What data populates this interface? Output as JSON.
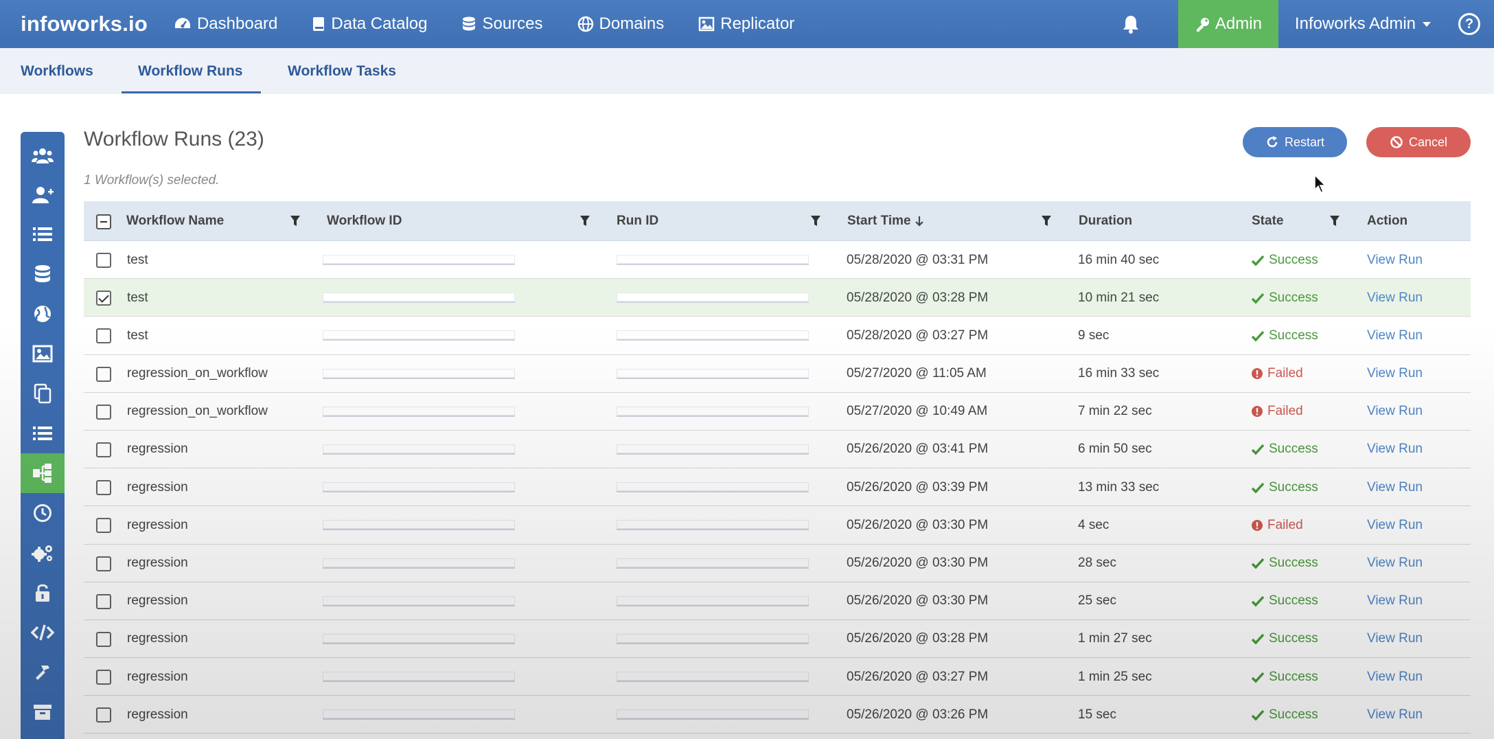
{
  "brand": "infoworks.io",
  "nav": [
    {
      "label": "Dashboard",
      "icon": "dashboard-icon"
    },
    {
      "label": "Data Catalog",
      "icon": "book-icon"
    },
    {
      "label": "Sources",
      "icon": "database-icon"
    },
    {
      "label": "Domains",
      "icon": "globe-icon"
    },
    {
      "label": "Replicator",
      "icon": "replicator-icon"
    }
  ],
  "admin_label": "Admin",
  "user_label": "Infoworks Admin",
  "help_label": "?",
  "subnav": {
    "tab1": "Workflows",
    "tab2": "Workflow Runs",
    "tab3": "Workflow Tasks",
    "active": "Workflow Runs"
  },
  "sidebar_icons": [
    "users-icon",
    "add-user-icon",
    "list-icon",
    "database-icon",
    "globe-icon",
    "image-icon",
    "copy-icon",
    "list-alt-icon",
    "workflow-icon",
    "clock-icon",
    "settings-icon",
    "unlock-icon",
    "code-icon",
    "hammer-icon",
    "archive-icon"
  ],
  "page": {
    "title": "Workflow Runs (23)",
    "selected_note": "1 Workflow(s) selected."
  },
  "buttons": {
    "restart": "Restart",
    "cancel": "Cancel"
  },
  "columns": {
    "name": "Workflow Name",
    "workflow_id": "Workflow ID",
    "run_id": "Run ID",
    "start_time": "Start Time",
    "duration": "Duration",
    "state": "State",
    "action": "Action"
  },
  "colors": {
    "navbar": "#3f6fb3",
    "admin": "#5fb85e",
    "restart": "#4f7fc4",
    "cancel": "#d9605a",
    "success": "#4a9a3c",
    "failed": "#d0574f",
    "link": "#4d86c9"
  },
  "rows": [
    {
      "name": "test",
      "start": "05/28/2020 @ 03:31 PM",
      "duration": "16 min 40 sec",
      "state": "Success",
      "action": "View Run",
      "checked": false
    },
    {
      "name": "test",
      "start": "05/28/2020 @ 03:28 PM",
      "duration": "10 min 21 sec",
      "state": "Success",
      "action": "View Run",
      "checked": true
    },
    {
      "name": "test",
      "start": "05/28/2020 @ 03:27 PM",
      "duration": "9 sec",
      "state": "Success",
      "action": "View Run",
      "checked": false
    },
    {
      "name": "regression_on_workflow",
      "start": "05/27/2020 @ 11:05 AM",
      "duration": "16 min 33 sec",
      "state": "Failed",
      "action": "View Run",
      "checked": false
    },
    {
      "name": "regression_on_workflow",
      "start": "05/27/2020 @ 10:49 AM",
      "duration": "7 min 22 sec",
      "state": "Failed",
      "action": "View Run",
      "checked": false
    },
    {
      "name": "regression",
      "start": "05/26/2020 @ 03:41 PM",
      "duration": "6 min 50 sec",
      "state": "Success",
      "action": "View Run",
      "checked": false
    },
    {
      "name": "regression",
      "start": "05/26/2020 @ 03:39 PM",
      "duration": "13 min 33 sec",
      "state": "Success",
      "action": "View Run",
      "checked": false
    },
    {
      "name": "regression",
      "start": "05/26/2020 @ 03:30 PM",
      "duration": "4 sec",
      "state": "Failed",
      "action": "View Run",
      "checked": false
    },
    {
      "name": "regression",
      "start": "05/26/2020 @ 03:30 PM",
      "duration": "28 sec",
      "state": "Success",
      "action": "View Run",
      "checked": false
    },
    {
      "name": "regression",
      "start": "05/26/2020 @ 03:30 PM",
      "duration": "25 sec",
      "state": "Success",
      "action": "View Run",
      "checked": false
    },
    {
      "name": "regression",
      "start": "05/26/2020 @ 03:28 PM",
      "duration": "1 min 27 sec",
      "state": "Success",
      "action": "View Run",
      "checked": false
    },
    {
      "name": "regression",
      "start": "05/26/2020 @ 03:27 PM",
      "duration": "1 min 25 sec",
      "state": "Success",
      "action": "View Run",
      "checked": false
    },
    {
      "name": "regression",
      "start": "05/26/2020 @ 03:26 PM",
      "duration": "15 sec",
      "state": "Success",
      "action": "View Run",
      "checked": false
    }
  ]
}
